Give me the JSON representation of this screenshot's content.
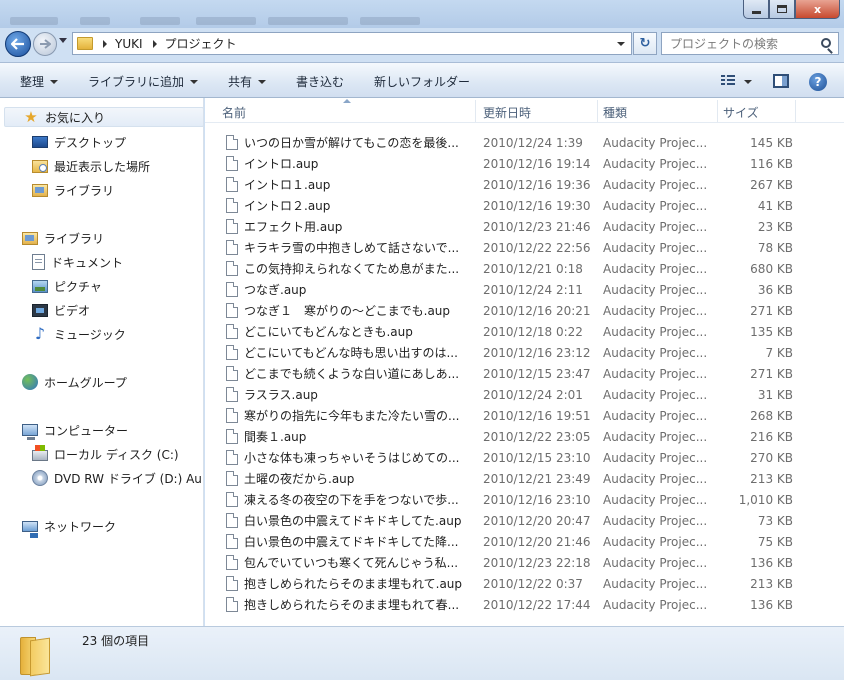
{
  "window": {
    "minimize_label": "",
    "maximize_label": "",
    "close_label": "x"
  },
  "address": {
    "breadcrumbs": [
      "YUKI",
      "プロジェクト"
    ],
    "refresh_glyph": "↻"
  },
  "search": {
    "placeholder": "プロジェクトの検索"
  },
  "toolbar": {
    "organize": "整理",
    "include_in_library": "ライブラリに追加",
    "share": "共有",
    "burn": "書き込む",
    "new_folder": "新しいフォルダー",
    "help": "?"
  },
  "sidebar": {
    "favorites": {
      "label": "お気に入り",
      "items": [
        {
          "label": "デスクトップ",
          "icon": "desktop-icon"
        },
        {
          "label": "最近表示した場所",
          "icon": "recent-places-icon"
        },
        {
          "label": "ライブラリ",
          "icon": "library-icon"
        }
      ]
    },
    "libraries": {
      "label": "ライブラリ",
      "items": [
        {
          "label": "ドキュメント",
          "icon": "documents-icon"
        },
        {
          "label": "ピクチャ",
          "icon": "pictures-icon"
        },
        {
          "label": "ビデオ",
          "icon": "videos-icon"
        },
        {
          "label": "ミュージック",
          "icon": "music-icon"
        }
      ]
    },
    "homegroup": {
      "label": "ホームグループ"
    },
    "computer": {
      "label": "コンピューター",
      "items": [
        {
          "label": "ローカル ディスク (C:)",
          "icon": "local-disk-icon"
        },
        {
          "label": "DVD RW ドライブ (D:) Au",
          "icon": "dvd-drive-icon"
        }
      ]
    },
    "network": {
      "label": "ネットワーク"
    }
  },
  "columns": {
    "name": "名前",
    "date": "更新日時",
    "type": "種類",
    "size": "サイズ"
  },
  "files": [
    {
      "name": "いつの日か雪が解けてもこの恋を最後...",
      "date": "2010/12/24 1:39",
      "type": "Audacity Projec...",
      "size": "145 KB"
    },
    {
      "name": "イントロ.aup",
      "date": "2010/12/16 19:14",
      "type": "Audacity Projec...",
      "size": "116 KB"
    },
    {
      "name": "イントロ１.aup",
      "date": "2010/12/16 19:36",
      "type": "Audacity Projec...",
      "size": "267 KB"
    },
    {
      "name": "イントロ２.aup",
      "date": "2010/12/16 19:30",
      "type": "Audacity Projec...",
      "size": "41 KB"
    },
    {
      "name": "エフェクト用.aup",
      "date": "2010/12/23 21:46",
      "type": "Audacity Projec...",
      "size": "23 KB"
    },
    {
      "name": "キラキラ雪の中抱きしめて話さないで...",
      "date": "2010/12/22 22:56",
      "type": "Audacity Projec...",
      "size": "78 KB"
    },
    {
      "name": "この気持抑えられなくてため息がまた...",
      "date": "2010/12/21 0:18",
      "type": "Audacity Projec...",
      "size": "680 KB"
    },
    {
      "name": "つなぎ.aup",
      "date": "2010/12/24 2:11",
      "type": "Audacity Projec...",
      "size": "36 KB"
    },
    {
      "name": "つなぎ１　寒がりの～どこまでも.aup",
      "date": "2010/12/16 20:21",
      "type": "Audacity Projec...",
      "size": "271 KB"
    },
    {
      "name": "どこにいてもどんなときも.aup",
      "date": "2010/12/18 0:22",
      "type": "Audacity Projec...",
      "size": "135 KB"
    },
    {
      "name": "どこにいてもどんな時も思い出すのは...",
      "date": "2010/12/16 23:12",
      "type": "Audacity Projec...",
      "size": "7 KB"
    },
    {
      "name": "どこまでも続くような白い道にあしあ...",
      "date": "2010/12/15 23:47",
      "type": "Audacity Projec...",
      "size": "271 KB"
    },
    {
      "name": "ラスラス.aup",
      "date": "2010/12/24 2:01",
      "type": "Audacity Projec...",
      "size": "31 KB"
    },
    {
      "name": "寒がりの指先に今年もまた冷たい雪の...",
      "date": "2010/12/16 19:51",
      "type": "Audacity Projec...",
      "size": "268 KB"
    },
    {
      "name": "間奏１.aup",
      "date": "2010/12/22 23:05",
      "type": "Audacity Projec...",
      "size": "216 KB"
    },
    {
      "name": "小さな体も凍っちゃいそうはじめての...",
      "date": "2010/12/15 23:10",
      "type": "Audacity Projec...",
      "size": "270 KB"
    },
    {
      "name": "土曜の夜だから.aup",
      "date": "2010/12/21 23:49",
      "type": "Audacity Projec...",
      "size": "213 KB"
    },
    {
      "name": "凍える冬の夜空の下を手をつないで歩...",
      "date": "2010/12/16 23:10",
      "type": "Audacity Projec...",
      "size": "1,010 KB"
    },
    {
      "name": "白い景色の中震えてドキドキしてた.aup",
      "date": "2010/12/20 20:47",
      "type": "Audacity Projec...",
      "size": "73 KB"
    },
    {
      "name": "白い景色の中震えてドキドキしてた降...",
      "date": "2010/12/20 21:46",
      "type": "Audacity Projec...",
      "size": "75 KB"
    },
    {
      "name": "包んでいていつも寒くて死んじゃう私...",
      "date": "2010/12/23 22:18",
      "type": "Audacity Projec...",
      "size": "136 KB"
    },
    {
      "name": "抱きしめられたらそのまま埋もれて.aup",
      "date": "2010/12/22 0:37",
      "type": "Audacity Projec...",
      "size": "213 KB"
    },
    {
      "name": "抱きしめられたらそのまま埋もれて春...",
      "date": "2010/12/22 17:44",
      "type": "Audacity Projec...",
      "size": "136 KB"
    }
  ],
  "status": {
    "item_count": "23 個の項目"
  },
  "colors": {
    "window_frame": "#cfe0f3",
    "command_bar": "#dce7f4",
    "header_text": "#4c607a",
    "secondary_text": "#6d6d6d",
    "close_button": "#c74a2f"
  }
}
